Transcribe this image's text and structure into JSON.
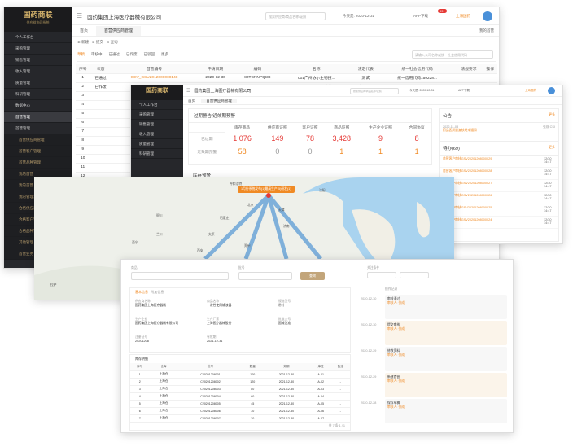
{
  "app": {
    "logo": "国药商联",
    "logo_sub": "供应链协同系统",
    "company": "国药集团上海医疗器械有限公司",
    "search_placeholder": "搜索供应商/商品名称/证照",
    "date": "今天是: 2020-12-31",
    "app_download": "APP下载",
    "badge": "99+",
    "user": "上海国药"
  },
  "back": {
    "sidebar": [
      "个人工作台",
      "采购管理",
      "销售管理",
      "收入管理",
      "质量管理",
      "科研管理",
      "数据中心",
      "首营管理",
      "首营管理"
    ],
    "sub": [
      "首营供应商管理",
      "首营客户管理",
      "首营品种管理",
      "我的首营",
      "我的首营",
      "我的管理流程",
      "合格供应商",
      "合格客户管理",
      "合格品种管理",
      "其他管理",
      "首营业务"
    ],
    "tabs": [
      "首页",
      "首营供应商管理"
    ],
    "tab_extra": "我的首营",
    "tools": [
      "新建",
      "提交",
      "查询"
    ],
    "filters": [
      "草稿",
      "审核中",
      "已通过",
      "已作废",
      "已驳回",
      "更多"
    ],
    "filter_right": "请输入公司名称或统一社会信用代码",
    "columns": [
      "序号",
      "状态",
      "首营编号",
      "申请日期",
      "编码",
      "名称",
      "法定代表",
      "统一社会信用代码",
      "法规要求",
      "操作"
    ],
    "rows": [
      [
        "1",
        "已通过",
        "GEV_GSU2012000000148",
        "2020-12-30",
        "80TCNNPQI38",
        "001广州协尔生物技...",
        "测试",
        "统一信用代码159228...",
        "-"
      ],
      [
        "2",
        "已作废",
        "GEV_GSU2012000000145",
        "2020-12-28",
        "MASG33RP1",
        "乐辰（深圳）公寓管...",
        "法人代表",
        "91440300MA5G33RP...",
        "-"
      ]
    ],
    "row_nums": [
      "3",
      "4",
      "5",
      "6",
      "7",
      "8",
      "9",
      "10",
      "11",
      "12",
      "13"
    ]
  },
  "mid": {
    "tabs": [
      "首页",
      "首营供应商管理"
    ],
    "title": "过期警告/近效期预警",
    "cols": [
      "库存商品",
      "供应商证照",
      "客户证照",
      "商品证照",
      "生产企业证照",
      "合同协议"
    ],
    "row1_label": "已过期",
    "row1": [
      "1,076",
      "149",
      "78",
      "3,428",
      "9",
      "8"
    ],
    "row2_label": "近效期预警",
    "row2": [
      "58",
      "0",
      "0",
      "1",
      "1",
      "1"
    ],
    "stock_title": "库存预警",
    "notice_title": "公告",
    "more": "更多",
    "notice": {
      "date": "2022-11-08",
      "text": "药品区质量复核结束通知",
      "user": "张成 CSI"
    },
    "todo_title": "待办(69)",
    "todo": [
      "首营客户审核GSV20201208000029",
      "首营客户审核GSV20201208000028",
      "首营客户审核GSV20201208000027",
      "首营客户审核GSV20201208000026",
      "首营客户审核GSV20201208000025",
      "首营客户审核GSV20201208000024"
    ],
    "todo_time": "12/30 14:47"
  },
  "map": {
    "tip": "1月份系统发布(1)最高生产(5)研发(1)",
    "cities": [
      "呼和浩特",
      "北京",
      "石家庄",
      "天津",
      "济南",
      "太原",
      "银川",
      "兰州",
      "西宁",
      "郑州",
      "西安",
      "拉萨",
      "沈阳"
    ]
  },
  "front": {
    "label1": "商品",
    "label2": "批号",
    "btn": "查询",
    "label3": "关注条件",
    "tabs": [
      "基本信息",
      "附加信息"
    ],
    "fields": [
      "供应商名称",
      "商品名称",
      "规格型号",
      "生产企业",
      "生产厂家",
      "批准文号",
      "注册证号",
      "有效期"
    ],
    "values": [
      "国药集团上海医疗器械",
      "一次性使用输液器",
      "带针",
      "国药集团上海医疗器械有限公司",
      "上海医疗器械股份",
      "国械注准",
      "20201208",
      "2021-12-31"
    ],
    "table_title": "库存明细",
    "table_cols": [
      "序号",
      "仓库",
      "批号",
      "数量",
      "效期",
      "库位",
      "备注"
    ],
    "table_rows": [
      [
        "1",
        "上海仓",
        "C20201208001",
        "100",
        "2021-12-30",
        "A-01",
        "-"
      ],
      [
        "2",
        "上海仓",
        "C20201208002",
        "120",
        "2021-12-30",
        "A-02",
        "-"
      ],
      [
        "3",
        "上海仓",
        "C20201208003",
        "80",
        "2021-12-30",
        "A-03",
        "-"
      ],
      [
        "4",
        "上海仓",
        "C20201208004",
        "60",
        "2021-12-30",
        "A-04",
        "-"
      ],
      [
        "5",
        "上海仓",
        "C20201208005",
        "45",
        "2021-12-30",
        "A-05",
        "-"
      ],
      [
        "6",
        "上海仓",
        "C20201208006",
        "30",
        "2021-12-30",
        "A-06",
        "-"
      ],
      [
        "7",
        "上海仓",
        "C20201208007",
        "20",
        "2021-12-30",
        "A-07",
        "-"
      ]
    ],
    "pager": "共 7 条 1 / 1",
    "timeline_title": "操作记录",
    "timeline": [
      [
        "2020-12-30",
        "审核通过",
        "审核人: 张成"
      ],
      [
        "2020-12-30",
        "提交审核",
        "审核人: 张成"
      ],
      [
        "2020-12-29",
        "修改资料",
        "审核人: 张成"
      ],
      [
        "2020-12-29",
        "新建首营",
        "审核人: 张成"
      ],
      [
        "2020-12-28",
        "保存草稿",
        "审核人: 张成"
      ]
    ]
  },
  "colors": {
    "accent": "#f08a24",
    "sidebar": "#26272b",
    "gold": "#c2a57a",
    "line": "#5b9bd5"
  }
}
